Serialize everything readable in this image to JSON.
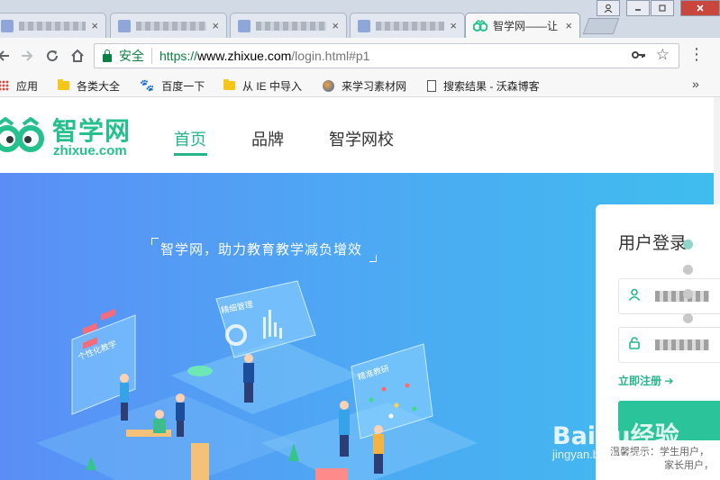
{
  "browser": {
    "tabs": [
      {
        "title": "",
        "blurred": true
      },
      {
        "title": "",
        "blurred": true
      },
      {
        "title": "",
        "blurred": true
      },
      {
        "title": "",
        "blurred": true
      },
      {
        "title": "智学网——让",
        "blurred": false,
        "active": true
      }
    ],
    "tab_close_glyph": "×",
    "window_controls": [
      "user-icon",
      "minimize-icon",
      "restore-icon",
      "close-icon"
    ],
    "address_bar": {
      "security_label": "安全",
      "url_scheme": "https://",
      "url_host": "www.zhixue.com",
      "url_path": "/login.html#p1"
    },
    "bookmarks": [
      {
        "label": "应用",
        "icon": "apps-icon"
      },
      {
        "label": "各类大全",
        "icon": "folder-icon"
      },
      {
        "label": "百度一下",
        "icon": "baidu-paw-icon"
      },
      {
        "label": "从 IE 中导入",
        "icon": "folder-icon"
      },
      {
        "label": "来学习素材网",
        "icon": "globe-icon"
      },
      {
        "label": "搜索结果 - 沃森博客",
        "icon": "page-icon"
      }
    ],
    "bookmarks_more": "»"
  },
  "site": {
    "logo_cn": "智学网",
    "logo_en": "zhixue.com",
    "nav": [
      {
        "label": "首页",
        "active": true
      },
      {
        "label": "品牌",
        "active": false
      },
      {
        "label": "智学网校",
        "active": false
      }
    ],
    "slogan": "智学网，助力教育教学减负增效",
    "illustration_labels": [
      "个性化教学",
      "精细管理",
      "精准教研"
    ]
  },
  "login": {
    "title": "用户登录",
    "register_label": "立即注册",
    "register_arrow": "➔",
    "hint_line1": "温馨提示：学生用户，",
    "hint_line2": "家长用户，"
  },
  "watermark": {
    "brand": "Baidu经验",
    "url": "jingyan.baidu.com"
  },
  "colors": {
    "brand_green": "#25c08c",
    "hero_start": "#5a8ef6",
    "hero_end": "#3fbdee",
    "login_button": "#2bc39a"
  }
}
